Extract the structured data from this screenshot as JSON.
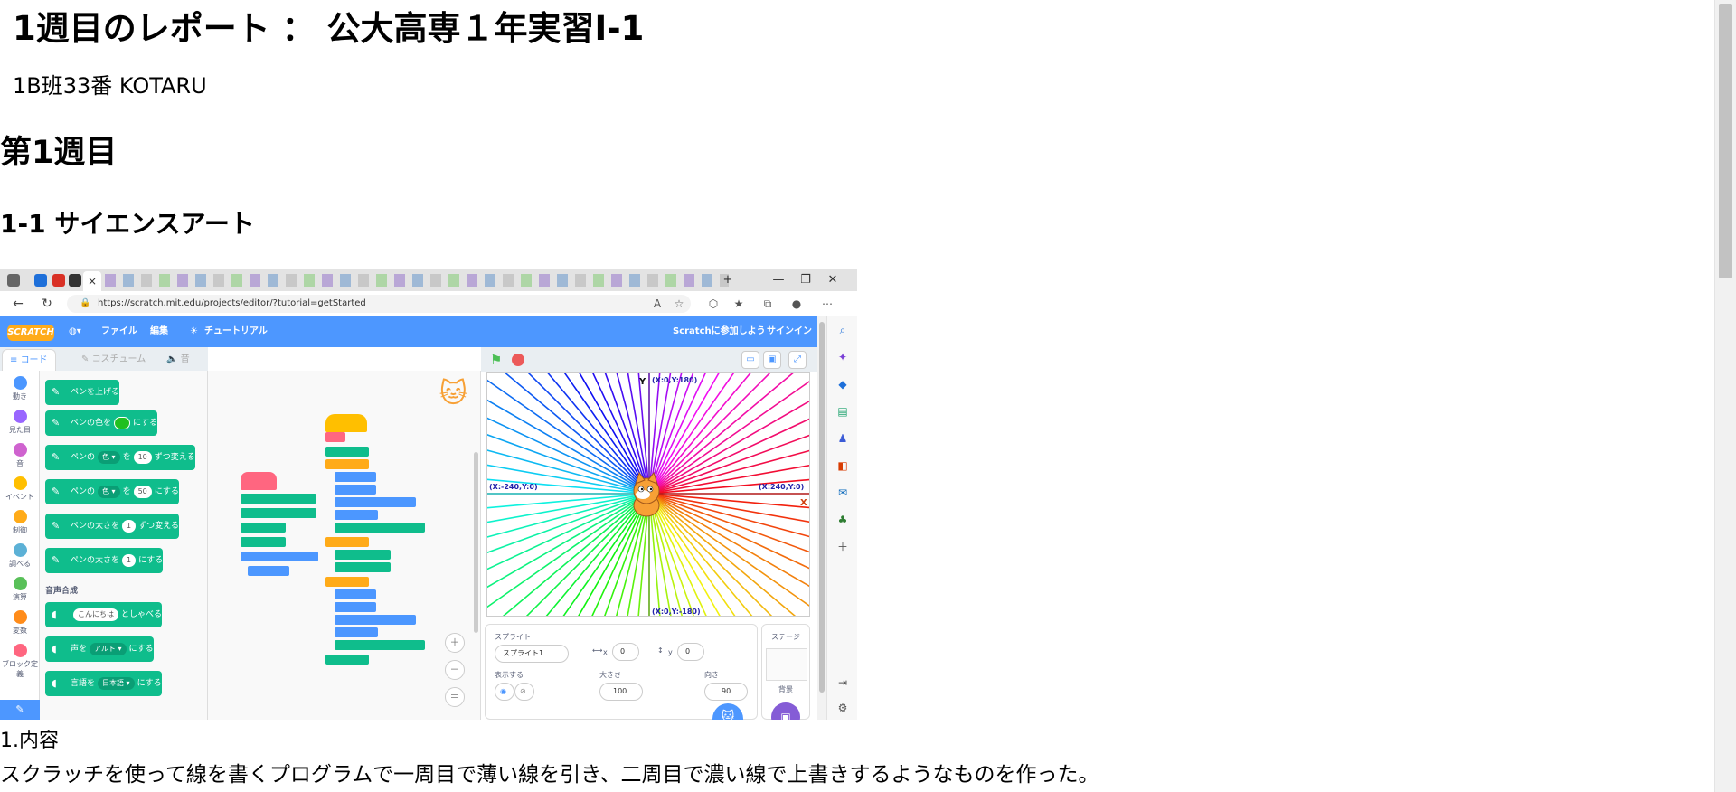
{
  "report": {
    "title": "1週目のレポート ： 公大高専１年実習I-1",
    "author": "1B班33番 KOTARU",
    "heading": "第1週目",
    "subheading": "1-1 サイエンスアート",
    "content_label": "1.内容",
    "content_text": "スクラッチを使って線を書くプログラムで一周目で薄い線を引き、二周目で濃い線で上書きするようなものを作った。"
  },
  "browser": {
    "url": "https://scratch.mit.edu/projects/editor/?tutorial=getStarted",
    "active_tab_close": "×",
    "new_tab": "+",
    "window_controls": [
      "—",
      "❐",
      "✕"
    ]
  },
  "scratch": {
    "logo": "SCRATCH",
    "menu": {
      "file": "ファイル",
      "edit": "編集",
      "tutorial": "チュートリアル",
      "join": "Scratchに参加しよう",
      "signin": "サインイン"
    },
    "tabs": {
      "code": "コード",
      "costume": "コスチューム",
      "sound": "音"
    },
    "categories": [
      {
        "label": "動き",
        "color": "#4c97ff"
      },
      {
        "label": "見た目",
        "color": "#9966ff"
      },
      {
        "label": "音",
        "color": "#cf63cf"
      },
      {
        "label": "イベント",
        "color": "#ffbf00"
      },
      {
        "label": "制御",
        "color": "#ffab19"
      },
      {
        "label": "調べる",
        "color": "#5cb1d6"
      },
      {
        "label": "演算",
        "color": "#59c059"
      },
      {
        "label": "変数",
        "color": "#ff8c1a"
      },
      {
        "label": "ブロック定義",
        "color": "#ff6680"
      }
    ],
    "blocks": {
      "pen_up": "ペンを上げる",
      "set_color_a": "ペンの色を",
      "set_color_b": "にする",
      "change_a": "ペンの",
      "change_dd": "色 ▾",
      "change_b": "を",
      "change_val": "10",
      "change_c": "ずつ変える",
      "set_a": "ペンの",
      "set_dd": "色 ▾",
      "set_b": "を",
      "set_val": "50",
      "set_c": "にする",
      "size_change_a": "ペンの太さを",
      "size_change_val": "1",
      "size_change_b": "ずつ変える",
      "size_set_a": "ペンの太さを",
      "size_set_val": "1",
      "size_set_b": "にする",
      "section_tts": "音声合成",
      "speak_val": "こんにちは",
      "speak_b": "としゃべる",
      "voice_a": "声を",
      "voice_dd": "アルト ▾",
      "voice_b": "にする",
      "lang_a": "言語を",
      "lang_dd": "日本語 ▾",
      "lang_b": "にする"
    },
    "stage_labels": {
      "top": "(X:0,Y:180)",
      "bottom": "(X:0,Y:-180)",
      "left": "(X:-240,Y:0)",
      "right": "(X:240,Y:0)",
      "y_axis": "Y",
      "x_axis": "X"
    },
    "sprite_panel": {
      "sprite_label": "スプライト",
      "sprite_name": "スプライト1",
      "x_label": "x",
      "x_val": "0",
      "y_label": "y",
      "y_val": "0",
      "show_label": "表示する",
      "size_label": "大きさ",
      "size_val": "100",
      "dir_label": "向き",
      "dir_val": "90",
      "stage_label": "ステージ",
      "backdrop_label": "背景"
    }
  }
}
